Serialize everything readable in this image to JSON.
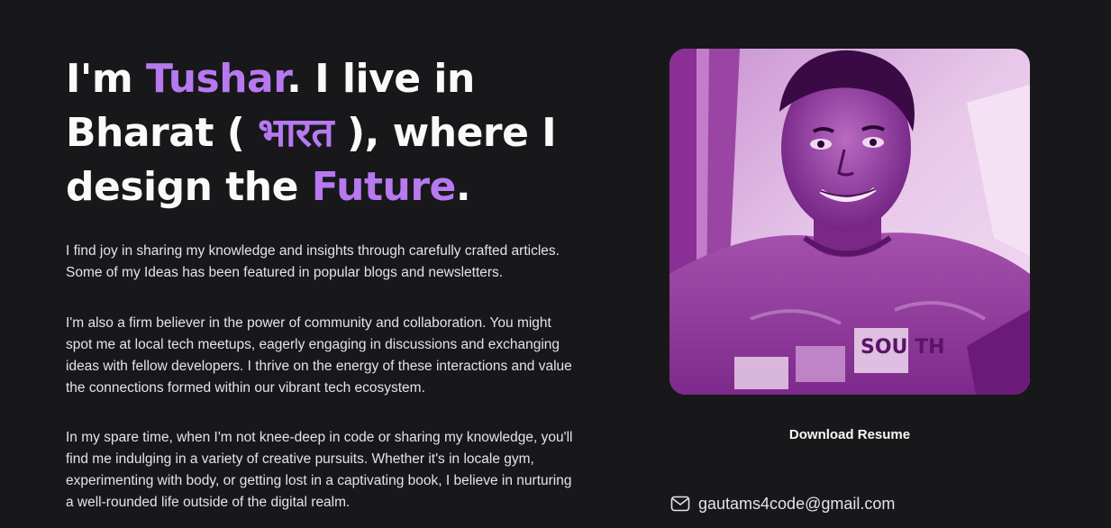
{
  "intro": {
    "line1_prefix": "I'm ",
    "name": "Tushar",
    "line1_suffix": ". I live in",
    "line2_prefix": "Bharat ( ",
    "country_native": "भारत",
    "line2_suffix": " ), where I",
    "line3_prefix": "design the ",
    "future": "Future",
    "line3_suffix": "."
  },
  "paragraphs": [
    "I find joy in sharing my knowledge and insights through carefully crafted articles. Some of my Ideas has been featured in popular blogs and newsletters.",
    "I'm also a firm believer in the power of community and collaboration. You might spot me at local tech meetups, eagerly engaging in discussions and exchanging ideas with fellow developers. I thrive on the energy of these interactions and value the connections formed within our vibrant tech ecosystem.",
    "In my spare time, when I'm not knee-deep in code or sharing my knowledge, you'll find me indulging in a variety of creative pursuits. Whether it's in locale gym, experimenting with body, or getting lost in a captivating book, I believe in nurturing a well-rounded life outside of the digital realm."
  ],
  "profile": {
    "photo_icon": "profile-photo",
    "tshirt_text": "SOU TH"
  },
  "actions": {
    "download_label": "Download Resume"
  },
  "contact": {
    "email_icon": "mail-icon",
    "email": "gautams4code@gmail.com"
  },
  "colors": {
    "background": "#18181b",
    "accent": "#b779f0",
    "text": "#f4f4f5"
  }
}
